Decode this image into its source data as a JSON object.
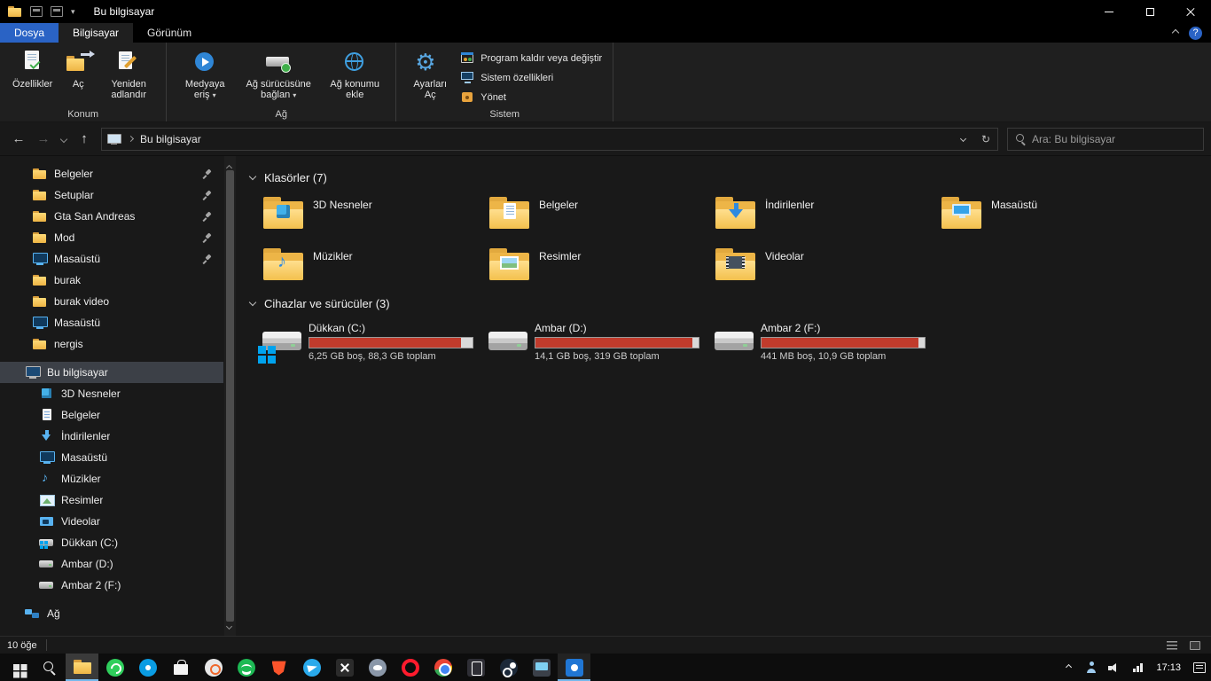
{
  "colors": {
    "accent_blue": "#2a63c5",
    "selection_gray": "#3c4047",
    "drive_used_red": "#c03b2c",
    "drive_free_gray": "#d9d9d9",
    "folder_yellow": "#f3c04d",
    "taskbar_black": "#0d0d0d"
  },
  "icons": {
    "back": "←",
    "forward": "→",
    "up": "↑",
    "refresh": "↻",
    "caret_down": "▾",
    "help": "?",
    "gear": "⚙",
    "music_note": "♪"
  },
  "window": {
    "title": "Bu bilgisayar"
  },
  "ribbon": {
    "tab_file": "Dosya",
    "tab_computer": "Bilgisayar",
    "tab_view": "Görünüm",
    "group_konum": {
      "label": "Konum",
      "properties": "Özellikler",
      "open": "Aç",
      "rename": "Yeniden adlandır"
    },
    "group_ag": {
      "label": "Ağ",
      "access_media": "Medyaya eriş",
      "map_network_drive": "Ağ sürücüsüne bağlan",
      "add_network_location": "Ağ konumu ekle"
    },
    "group_sistem": {
      "label": "Sistem",
      "open_settings": "Ayarları Aç",
      "uninstall": "Program kaldır veya değiştir",
      "system_properties": "Sistem özellikleri",
      "manage": "Yönet"
    }
  },
  "navigation": {
    "breadcrumb": "Bu bilgisayar",
    "search_placeholder": "Ara: Bu bilgisayar"
  },
  "sidebar": {
    "items": [
      {
        "label": "Belgeler",
        "icon": "folder",
        "pinned": true
      },
      {
        "label": "Setuplar",
        "icon": "folder",
        "pinned": true
      },
      {
        "label": "Gta San Andreas",
        "icon": "folder",
        "pinned": true
      },
      {
        "label": "Mod",
        "icon": "folder",
        "pinned": true
      },
      {
        "label": "Masaüstü",
        "icon": "desktop",
        "pinned": true
      },
      {
        "label": "burak",
        "icon": "folder"
      },
      {
        "label": "burak video",
        "icon": "folder"
      },
      {
        "label": "Masaüstü",
        "icon": "desktop"
      },
      {
        "label": "nergis",
        "icon": "folder"
      },
      {
        "label": "Bu bilgisayar",
        "icon": "computer",
        "selected": true
      },
      {
        "label": "3D Nesneler",
        "icon": "3d-objects"
      },
      {
        "label": "Belgeler",
        "icon": "documents"
      },
      {
        "label": "İndirilenler",
        "icon": "downloads"
      },
      {
        "label": "Masaüstü",
        "icon": "desktop"
      },
      {
        "label": "Müzikler",
        "icon": "music"
      },
      {
        "label": "Resimler",
        "icon": "pictures"
      },
      {
        "label": "Videolar",
        "icon": "videos"
      },
      {
        "label": "Dükkan (C:)",
        "icon": "system-drive"
      },
      {
        "label": "Ambar (D:)",
        "icon": "drive"
      },
      {
        "label": "Ambar 2 (F:)",
        "icon": "drive"
      },
      {
        "label": "Ağ",
        "icon": "network"
      }
    ]
  },
  "content": {
    "folders_section": "Klasörler (7)",
    "drives_section": "Cihazlar ve sürücüler (3)",
    "folders": [
      {
        "label": "3D Nesneler",
        "icon": "folder-3d-objects"
      },
      {
        "label": "Belgeler",
        "icon": "folder-documents"
      },
      {
        "label": "İndirilenler",
        "icon": "folder-downloads"
      },
      {
        "label": "Masaüstü",
        "icon": "folder-desktop"
      },
      {
        "label": "Müzikler",
        "icon": "folder-music"
      },
      {
        "label": "Resimler",
        "icon": "folder-pictures"
      },
      {
        "label": "Videolar",
        "icon": "folder-videos"
      }
    ],
    "drives": [
      {
        "name": "Dükkan (C:)",
        "caption": "6,25 GB boş, 88,3 GB toplam",
        "used_pct": 93,
        "icon": "hdd-windows"
      },
      {
        "name": "Ambar (D:)",
        "caption": "14,1 GB boş, 319 GB toplam",
        "used_pct": 96,
        "icon": "hdd"
      },
      {
        "name": "Ambar 2 (F:)",
        "caption": "441 MB boş, 10,9 GB toplam",
        "used_pct": 96,
        "icon": "hdd"
      }
    ]
  },
  "statusbar": {
    "items_count": "10 öğe"
  },
  "taskbar": {
    "items": [
      "start",
      "search",
      "file-explorer",
      "whatsapp",
      "skype",
      "microsoft-store",
      "origin",
      "spotify",
      "brave",
      "telegram",
      "x-app",
      "discord",
      "opera",
      "chrome",
      "epic-games",
      "steam",
      "media-app",
      "photos"
    ],
    "tray": {
      "time": "17:13"
    }
  }
}
